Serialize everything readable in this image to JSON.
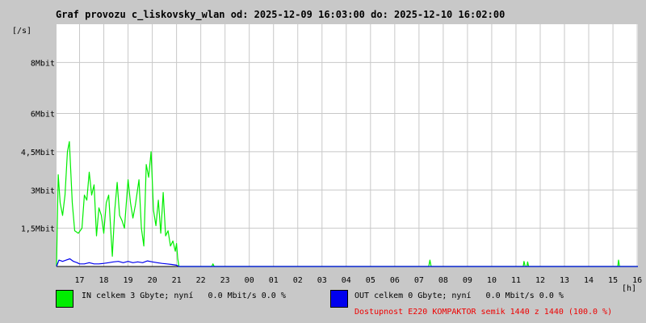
{
  "title": "Graf provozu c_liskovsky_wlan od: 2025-12-09 16:03:00 do: 2025-12-10 16:02:00",
  "colors": {
    "background": "#c8c8c8",
    "plot": "#ffffff",
    "grid": "#c8c8c8",
    "in": "#00ee00",
    "out": "#0000ee",
    "availability": "#ee0000"
  },
  "legend": {
    "in": {
      "text": "IN celkem 3 Gbyte; nyní   0.0 Mbit/s 0.0 %",
      "color": "#00ee00"
    },
    "out": {
      "text": "OUT celkem 0 Gbyte; nyní   0.0 Mbit/s 0.0 %",
      "color": "#0000ee"
    }
  },
  "availability_text": "Dostupnost E220 KOMPAKTOR semik 1440 z 1440 (100.0 %)",
  "chart_data": {
    "type": "area",
    "ylabel": "[/s]",
    "xlabel": "[h]",
    "ylim": [
      0,
      9.5
    ],
    "xlim": [
      16.05,
      40.03
    ],
    "y_ticks": [
      {
        "value": 1.5,
        "label": "1,5Mbit"
      },
      {
        "value": 3,
        "label": "3Mbit"
      },
      {
        "value": 4.5,
        "label": "4,5Mbit"
      },
      {
        "value": 6,
        "label": "6Mbit"
      },
      {
        "value": 8,
        "label": "8Mbit"
      }
    ],
    "x_ticks": [
      {
        "value": 17,
        "label": "17"
      },
      {
        "value": 18,
        "label": "18"
      },
      {
        "value": 19,
        "label": "19"
      },
      {
        "value": 20,
        "label": "20"
      },
      {
        "value": 21,
        "label": "21"
      },
      {
        "value": 22,
        "label": "22"
      },
      {
        "value": 23,
        "label": "23"
      },
      {
        "value": 24,
        "label": "00"
      },
      {
        "value": 25,
        "label": "01"
      },
      {
        "value": 26,
        "label": "02"
      },
      {
        "value": 27,
        "label": "03"
      },
      {
        "value": 28,
        "label": "04"
      },
      {
        "value": 29,
        "label": "05"
      },
      {
        "value": 30,
        "label": "06"
      },
      {
        "value": 31,
        "label": "07"
      },
      {
        "value": 32,
        "label": "08"
      },
      {
        "value": 33,
        "label": "09"
      },
      {
        "value": 34,
        "label": "10"
      },
      {
        "value": 35,
        "label": "11"
      },
      {
        "value": 36,
        "label": "12"
      },
      {
        "value": 37,
        "label": "13"
      },
      {
        "value": 38,
        "label": "14"
      },
      {
        "value": 39,
        "label": "15"
      },
      {
        "value": 40,
        "label": "16"
      }
    ],
    "grid": true,
    "series": [
      {
        "name": "IN",
        "color": "#00ee00",
        "points": [
          [
            16.05,
            0.0
          ],
          [
            16.12,
            3.6
          ],
          [
            16.2,
            2.5
          ],
          [
            16.3,
            2.0
          ],
          [
            16.4,
            2.8
          ],
          [
            16.5,
            4.5
          ],
          [
            16.58,
            4.9
          ],
          [
            16.7,
            2.5
          ],
          [
            16.8,
            1.4
          ],
          [
            16.95,
            1.3
          ],
          [
            17.1,
            1.5
          ],
          [
            17.2,
            2.8
          ],
          [
            17.3,
            2.6
          ],
          [
            17.4,
            3.7
          ],
          [
            17.5,
            2.8
          ],
          [
            17.6,
            3.2
          ],
          [
            17.7,
            1.2
          ],
          [
            17.8,
            2.3
          ],
          [
            17.9,
            2.0
          ],
          [
            18.0,
            1.3
          ],
          [
            18.1,
            2.5
          ],
          [
            18.2,
            2.8
          ],
          [
            18.35,
            0.4
          ],
          [
            18.45,
            2.2
          ],
          [
            18.55,
            3.3
          ],
          [
            18.65,
            2.0
          ],
          [
            18.75,
            1.8
          ],
          [
            18.85,
            1.5
          ],
          [
            19.0,
            3.4
          ],
          [
            19.1,
            2.5
          ],
          [
            19.2,
            1.9
          ],
          [
            19.3,
            2.4
          ],
          [
            19.45,
            3.4
          ],
          [
            19.55,
            1.5
          ],
          [
            19.65,
            0.8
          ],
          [
            19.75,
            4.0
          ],
          [
            19.85,
            3.5
          ],
          [
            19.95,
            4.5
          ],
          [
            20.05,
            2.2
          ],
          [
            20.15,
            1.6
          ],
          [
            20.25,
            2.6
          ],
          [
            20.35,
            1.3
          ],
          [
            20.45,
            2.9
          ],
          [
            20.55,
            1.2
          ],
          [
            20.65,
            1.4
          ],
          [
            20.75,
            0.8
          ],
          [
            20.85,
            1.0
          ],
          [
            20.95,
            0.6
          ],
          [
            21.0,
            0.9
          ],
          [
            21.05,
            0.3
          ],
          [
            21.1,
            0.0
          ],
          [
            22.45,
            0.0
          ],
          [
            22.5,
            0.1
          ],
          [
            22.55,
            0.0
          ],
          [
            31.4,
            0.0
          ],
          [
            31.45,
            0.25
          ],
          [
            31.5,
            0.0
          ],
          [
            35.3,
            0.0
          ],
          [
            35.33,
            0.2
          ],
          [
            35.38,
            0.0
          ],
          [
            35.45,
            0.0
          ],
          [
            35.48,
            0.18
          ],
          [
            35.52,
            0.0
          ],
          [
            39.2,
            0.0
          ],
          [
            39.23,
            0.25
          ],
          [
            39.27,
            0.0
          ],
          [
            40.03,
            0.0
          ]
        ]
      },
      {
        "name": "OUT",
        "color": "#0000ee",
        "points": [
          [
            16.05,
            0.0
          ],
          [
            16.15,
            0.25
          ],
          [
            16.3,
            0.2
          ],
          [
            16.45,
            0.25
          ],
          [
            16.6,
            0.3
          ],
          [
            16.75,
            0.2
          ],
          [
            16.9,
            0.15
          ],
          [
            17.0,
            0.1
          ],
          [
            17.2,
            0.1
          ],
          [
            17.4,
            0.15
          ],
          [
            17.6,
            0.1
          ],
          [
            17.8,
            0.1
          ],
          [
            18.0,
            0.12
          ],
          [
            18.2,
            0.15
          ],
          [
            18.4,
            0.18
          ],
          [
            18.6,
            0.2
          ],
          [
            18.8,
            0.15
          ],
          [
            19.0,
            0.2
          ],
          [
            19.2,
            0.15
          ],
          [
            19.4,
            0.18
          ],
          [
            19.6,
            0.15
          ],
          [
            19.8,
            0.22
          ],
          [
            20.0,
            0.18
          ],
          [
            20.2,
            0.15
          ],
          [
            20.4,
            0.12
          ],
          [
            20.6,
            0.1
          ],
          [
            20.8,
            0.08
          ],
          [
            21.0,
            0.05
          ],
          [
            21.1,
            0.0
          ],
          [
            40.03,
            0.0
          ]
        ]
      }
    ]
  }
}
